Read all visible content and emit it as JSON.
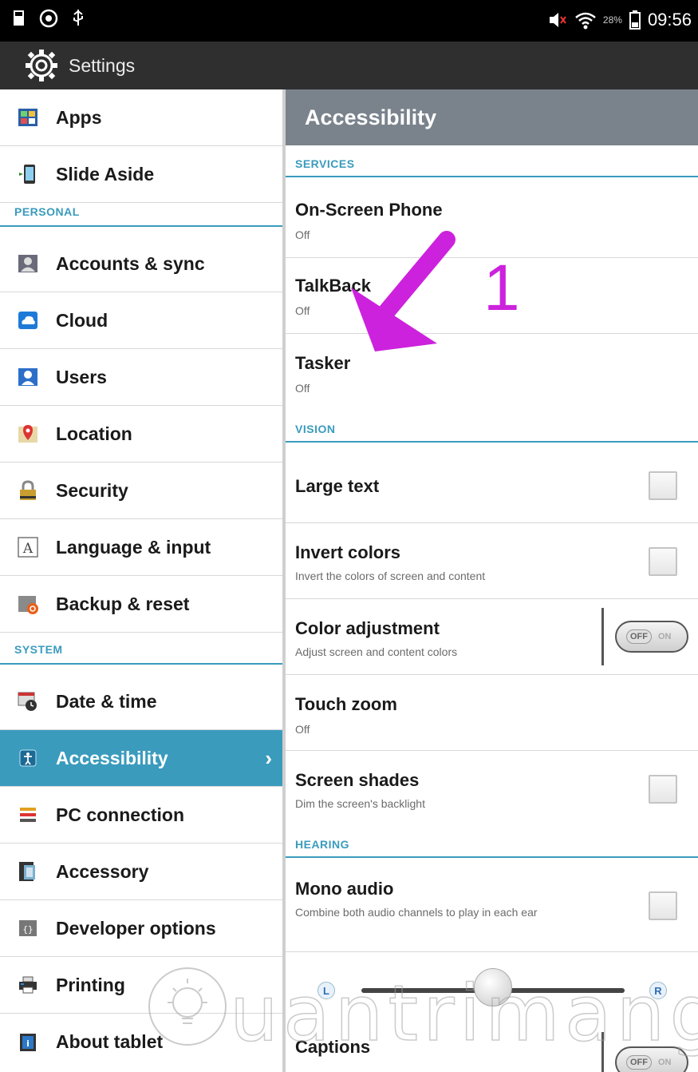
{
  "status_bar": {
    "battery_percent": "28%",
    "time": "09:56"
  },
  "action_bar": {
    "title": "Settings"
  },
  "sidebar": {
    "sections": [
      {
        "header": ""
      },
      {
        "header": "PERSONAL"
      },
      {
        "header": "SYSTEM"
      }
    ],
    "items": [
      {
        "label": "Apps",
        "icon": "apps-icon"
      },
      {
        "label": "Slide Aside",
        "icon": "slide-aside-icon"
      },
      {
        "label": "Accounts & sync",
        "icon": "accounts-icon"
      },
      {
        "label": "Cloud",
        "icon": "cloud-icon"
      },
      {
        "label": "Users",
        "icon": "users-icon"
      },
      {
        "label": "Location",
        "icon": "location-icon"
      },
      {
        "label": "Security",
        "icon": "lock-icon"
      },
      {
        "label": "Language & input",
        "icon": "language-icon"
      },
      {
        "label": "Backup & reset",
        "icon": "backup-icon"
      },
      {
        "label": "Date & time",
        "icon": "calendar-icon"
      },
      {
        "label": "Accessibility",
        "icon": "accessibility-icon",
        "active": true
      },
      {
        "label": "PC connection",
        "icon": "pc-connection-icon"
      },
      {
        "label": "Accessory",
        "icon": "accessory-icon"
      },
      {
        "label": "Developer options",
        "icon": "developer-icon"
      },
      {
        "label": "Printing",
        "icon": "printer-icon"
      },
      {
        "label": "About tablet",
        "icon": "about-icon"
      }
    ],
    "active_chevron": "›"
  },
  "detail": {
    "title": "Accessibility",
    "sections": {
      "services": "SERVICES",
      "vision": "VISION",
      "hearing": "HEARING"
    },
    "items": {
      "on_screen_phone": {
        "title": "On-Screen Phone",
        "summary": "Off"
      },
      "talkback": {
        "title": "TalkBack",
        "summary": "Off"
      },
      "tasker": {
        "title": "Tasker",
        "summary": "Off"
      },
      "large_text": {
        "title": "Large text"
      },
      "invert_colors": {
        "title": "Invert colors",
        "summary": "Invert the colors of screen and content"
      },
      "color_adjustment": {
        "title": "Color adjustment",
        "summary": "Adjust screen and content colors",
        "toggle_off": "OFF",
        "toggle_on": "ON"
      },
      "touch_zoom": {
        "title": "Touch zoom",
        "summary": "Off"
      },
      "screen_shades": {
        "title": "Screen shades",
        "summary": "Dim the screen's backlight"
      },
      "mono_audio": {
        "title": "Mono audio",
        "summary": "Combine both audio channels to play in each ear"
      },
      "balance": {
        "left": "L",
        "right": "R",
        "level": 0.5
      },
      "captions": {
        "title": "Captions",
        "toggle_off": "OFF",
        "toggle_on": "ON"
      }
    }
  },
  "annotation": {
    "label": "1",
    "color": "#cc22dd"
  },
  "watermark": {
    "text": "uantrimang"
  },
  "colors": {
    "accent": "#3a9bbd",
    "status_bar": "#000000",
    "action_bar": "#2f2f2f",
    "detail_header": "#7a838c"
  }
}
